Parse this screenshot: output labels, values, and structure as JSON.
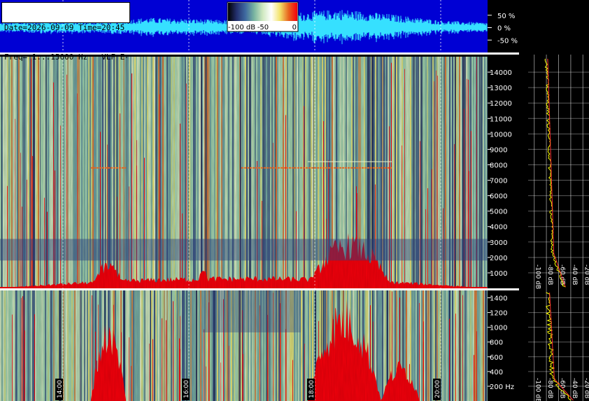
{
  "header": {
    "date_line": "Date=2026-09-09 Time=20:45",
    "freq_line": "Freq= 1...15000 Hz   VLF E-field ©www.vlf.it"
  },
  "colorbar": {
    "tick_labels": [
      "-100 dB",
      "-50",
      "0"
    ],
    "stops": [
      "#000000",
      "#24306e",
      "#3f6aa0",
      "#78b4a0",
      "#cfe8c0",
      "#ffffff",
      "#f3e36a",
      "#e8641e",
      "#f4000c"
    ]
  },
  "colors": {
    "waveform_bg": "#0000d4",
    "waveform": "#36e0ff",
    "spectrum_trace": "#ffff00",
    "average_trace": "#ff3030",
    "separator": "#ffffff",
    "grid": "#ffffff"
  },
  "chart_data": [
    {
      "type": "line",
      "panel": "waveform",
      "ylabel_ticks": [
        "50 %",
        "0 %",
        "-50 %"
      ],
      "y_ticks": [
        50,
        0,
        -50
      ],
      "ylim": [
        -100,
        100
      ],
      "description_series": [
        {
          "name": "",
          "envelope_peak_percent": [
            20,
            30,
            25,
            40,
            35,
            28,
            60,
            75,
            55,
            30,
            20
          ]
        }
      ]
    },
    {
      "type": "heatmap",
      "panel": "spectrogram-high",
      "y_ticks": [
        1000,
        2000,
        3000,
        4000,
        5000,
        6000,
        7000,
        8000,
        9000,
        10000,
        11000,
        12000,
        13000,
        14000
      ],
      "y_tick_labels": [
        "1000",
        "2000",
        "3000",
        "4000",
        "5000",
        "6000",
        "7000",
        "8000",
        "9000",
        "10000",
        "11000",
        "12000",
        "13000",
        "14000"
      ],
      "ylim": [
        0,
        15000
      ],
      "zlim": [
        -100,
        0
      ]
    },
    {
      "type": "heatmap",
      "panel": "spectrogram-low",
      "y_ticks": [
        200,
        400,
        600,
        800,
        1000,
        1200,
        1400
      ],
      "y_tick_labels": [
        "200 Hz",
        "400",
        "600",
        "800",
        "1000",
        "1200",
        "1400"
      ],
      "ylim": [
        0,
        1500
      ],
      "time_ticks": [
        "14:00",
        "16:00",
        "18:00",
        "20:00"
      ],
      "zlim": [
        -100,
        0
      ]
    },
    {
      "type": "line",
      "panel": "spectrum-profile",
      "x_ticks": [
        -100,
        -80,
        -60,
        -40,
        -20
      ],
      "x_tick_labels": [
        "-100 dB",
        "-80 dB",
        "-60 dB",
        "-40 dB",
        "-20 dB"
      ],
      "xlim": [
        -110,
        -10
      ]
    }
  ]
}
